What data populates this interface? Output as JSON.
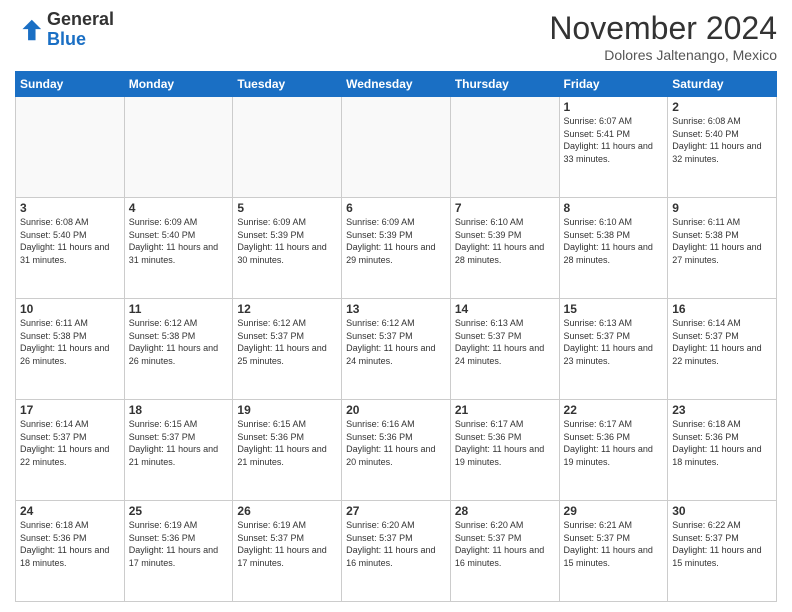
{
  "header": {
    "logo_general": "General",
    "logo_blue": "Blue",
    "month_title": "November 2024",
    "location": "Dolores Jaltenango, Mexico"
  },
  "days_of_week": [
    "Sunday",
    "Monday",
    "Tuesday",
    "Wednesday",
    "Thursday",
    "Friday",
    "Saturday"
  ],
  "weeks": [
    [
      {
        "day": "",
        "empty": true
      },
      {
        "day": "",
        "empty": true
      },
      {
        "day": "",
        "empty": true
      },
      {
        "day": "",
        "empty": true
      },
      {
        "day": "",
        "empty": true
      },
      {
        "day": "1",
        "sunrise": "6:07 AM",
        "sunset": "5:41 PM",
        "daylight": "11 hours and 33 minutes."
      },
      {
        "day": "2",
        "sunrise": "6:08 AM",
        "sunset": "5:40 PM",
        "daylight": "11 hours and 32 minutes."
      }
    ],
    [
      {
        "day": "3",
        "sunrise": "6:08 AM",
        "sunset": "5:40 PM",
        "daylight": "11 hours and 31 minutes."
      },
      {
        "day": "4",
        "sunrise": "6:09 AM",
        "sunset": "5:40 PM",
        "daylight": "11 hours and 31 minutes."
      },
      {
        "day": "5",
        "sunrise": "6:09 AM",
        "sunset": "5:39 PM",
        "daylight": "11 hours and 30 minutes."
      },
      {
        "day": "6",
        "sunrise": "6:09 AM",
        "sunset": "5:39 PM",
        "daylight": "11 hours and 29 minutes."
      },
      {
        "day": "7",
        "sunrise": "6:10 AM",
        "sunset": "5:39 PM",
        "daylight": "11 hours and 28 minutes."
      },
      {
        "day": "8",
        "sunrise": "6:10 AM",
        "sunset": "5:38 PM",
        "daylight": "11 hours and 28 minutes."
      },
      {
        "day": "9",
        "sunrise": "6:11 AM",
        "sunset": "5:38 PM",
        "daylight": "11 hours and 27 minutes."
      }
    ],
    [
      {
        "day": "10",
        "sunrise": "6:11 AM",
        "sunset": "5:38 PM",
        "daylight": "11 hours and 26 minutes."
      },
      {
        "day": "11",
        "sunrise": "6:12 AM",
        "sunset": "5:38 PM",
        "daylight": "11 hours and 26 minutes."
      },
      {
        "day": "12",
        "sunrise": "6:12 AM",
        "sunset": "5:37 PM",
        "daylight": "11 hours and 25 minutes."
      },
      {
        "day": "13",
        "sunrise": "6:12 AM",
        "sunset": "5:37 PM",
        "daylight": "11 hours and 24 minutes."
      },
      {
        "day": "14",
        "sunrise": "6:13 AM",
        "sunset": "5:37 PM",
        "daylight": "11 hours and 24 minutes."
      },
      {
        "day": "15",
        "sunrise": "6:13 AM",
        "sunset": "5:37 PM",
        "daylight": "11 hours and 23 minutes."
      },
      {
        "day": "16",
        "sunrise": "6:14 AM",
        "sunset": "5:37 PM",
        "daylight": "11 hours and 22 minutes."
      }
    ],
    [
      {
        "day": "17",
        "sunrise": "6:14 AM",
        "sunset": "5:37 PM",
        "daylight": "11 hours and 22 minutes."
      },
      {
        "day": "18",
        "sunrise": "6:15 AM",
        "sunset": "5:37 PM",
        "daylight": "11 hours and 21 minutes."
      },
      {
        "day": "19",
        "sunrise": "6:15 AM",
        "sunset": "5:36 PM",
        "daylight": "11 hours and 21 minutes."
      },
      {
        "day": "20",
        "sunrise": "6:16 AM",
        "sunset": "5:36 PM",
        "daylight": "11 hours and 20 minutes."
      },
      {
        "day": "21",
        "sunrise": "6:17 AM",
        "sunset": "5:36 PM",
        "daylight": "11 hours and 19 minutes."
      },
      {
        "day": "22",
        "sunrise": "6:17 AM",
        "sunset": "5:36 PM",
        "daylight": "11 hours and 19 minutes."
      },
      {
        "day": "23",
        "sunrise": "6:18 AM",
        "sunset": "5:36 PM",
        "daylight": "11 hours and 18 minutes."
      }
    ],
    [
      {
        "day": "24",
        "sunrise": "6:18 AM",
        "sunset": "5:36 PM",
        "daylight": "11 hours and 18 minutes."
      },
      {
        "day": "25",
        "sunrise": "6:19 AM",
        "sunset": "5:36 PM",
        "daylight": "11 hours and 17 minutes."
      },
      {
        "day": "26",
        "sunrise": "6:19 AM",
        "sunset": "5:37 PM",
        "daylight": "11 hours and 17 minutes."
      },
      {
        "day": "27",
        "sunrise": "6:20 AM",
        "sunset": "5:37 PM",
        "daylight": "11 hours and 16 minutes."
      },
      {
        "day": "28",
        "sunrise": "6:20 AM",
        "sunset": "5:37 PM",
        "daylight": "11 hours and 16 minutes."
      },
      {
        "day": "29",
        "sunrise": "6:21 AM",
        "sunset": "5:37 PM",
        "daylight": "11 hours and 15 minutes."
      },
      {
        "day": "30",
        "sunrise": "6:22 AM",
        "sunset": "5:37 PM",
        "daylight": "11 hours and 15 minutes."
      }
    ]
  ]
}
